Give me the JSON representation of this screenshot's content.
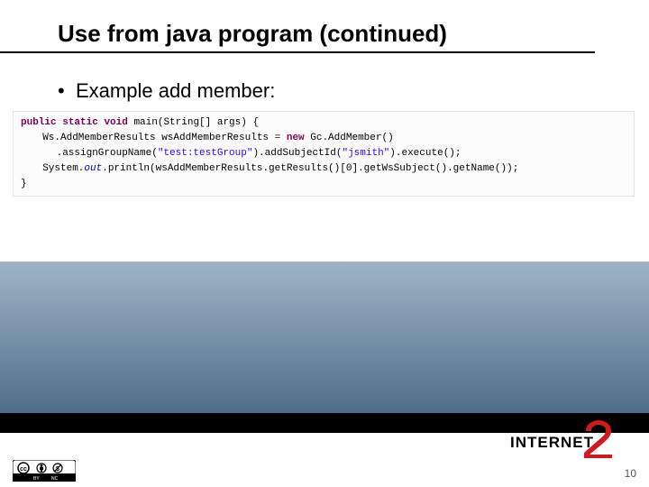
{
  "title": "Use from java program (continued)",
  "bullet": "Example add member:",
  "code": {
    "kw_public": "public",
    "kw_static": "static",
    "kw_void": "void",
    "kw_new": "new",
    "main_sig_mid": " main(String[] args) {",
    "line2_a": "Ws.AddMemberResults wsAddMemberResults = ",
    "line2_b": " Gc.AddMember()",
    "line3_a": ".assignGroupName(",
    "line3_str1": "\"test:testGroup\"",
    "line3_b": ").addSubjectId(",
    "line3_str2": "\"jsmith\"",
    "line3_c": ").execute();",
    "line4_a": "System.",
    "line4_out": "out",
    "line4_b": ".println(wsAddMemberResults.getResults()[0].getWsSubject().getName());",
    "line5": "}"
  },
  "logo_text": "INTERNET",
  "page_number": "10",
  "cc_alt": "Creative Commons BY-NC"
}
